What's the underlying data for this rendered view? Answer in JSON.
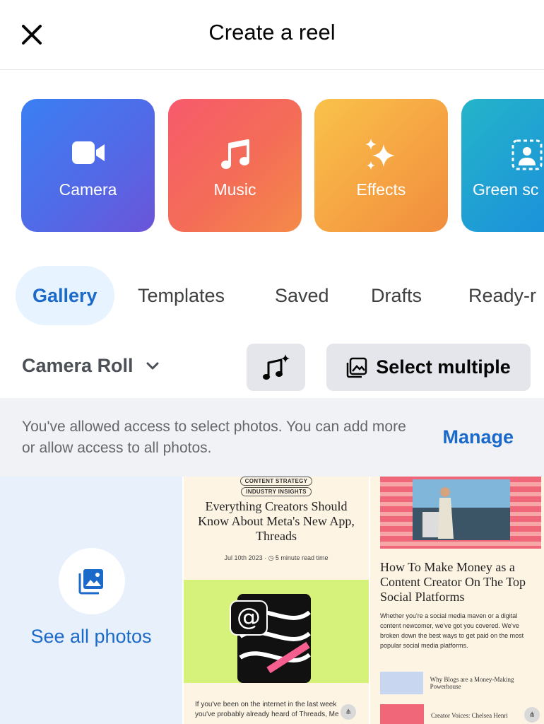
{
  "header": {
    "title": "Create a reel"
  },
  "tools": [
    {
      "label": "Camera",
      "icon": "video-camera-icon"
    },
    {
      "label": "Music",
      "icon": "music-note-icon"
    },
    {
      "label": "Effects",
      "icon": "sparkles-icon"
    },
    {
      "label": "Green sc",
      "icon": "green-screen-icon"
    }
  ],
  "tabs": [
    {
      "label": "Gallery",
      "active": true
    },
    {
      "label": "Templates"
    },
    {
      "label": "Saved"
    },
    {
      "label": "Drafts"
    },
    {
      "label": "Ready-r"
    }
  ],
  "controls": {
    "album": "Camera Roll",
    "select_multiple": "Select multiple"
  },
  "banner": {
    "text": "You've allowed access to select photos. You can add more or allow access to all photos.",
    "action": "Manage"
  },
  "grid": {
    "see_all": "See all photos",
    "thumb1": {
      "tag1": "CONTENT STRATEGY",
      "tag2": "INDUSTRY INSIGHTS",
      "title": "Everything Creators Should Know About Meta's New App, Threads",
      "meta": "Jul 10th 2023 · ◷ 5 minute read time",
      "excerpt": "If you've been on the internet in the last week you've probably already heard of Threads, Me"
    },
    "thumb2": {
      "title": "How To Make Money as a Content Creator On The Top Social Platforms",
      "text": "Whether you're a social media maven or a digital content newcomer, we've got you covered. We've broken down the best ways to get paid on the most popular social media platforms.",
      "link1": "Why Blogs are a Money-Making Powerhouse",
      "link2": "Creator Voices: Chelsea Henri"
    }
  },
  "colors": {
    "accent": "#1b6ac9",
    "camera_tile": "#4a73ec",
    "music_tile": "#f4665f",
    "effects_tile": "#f6a443",
    "green_tile": "#1e9ad6"
  }
}
